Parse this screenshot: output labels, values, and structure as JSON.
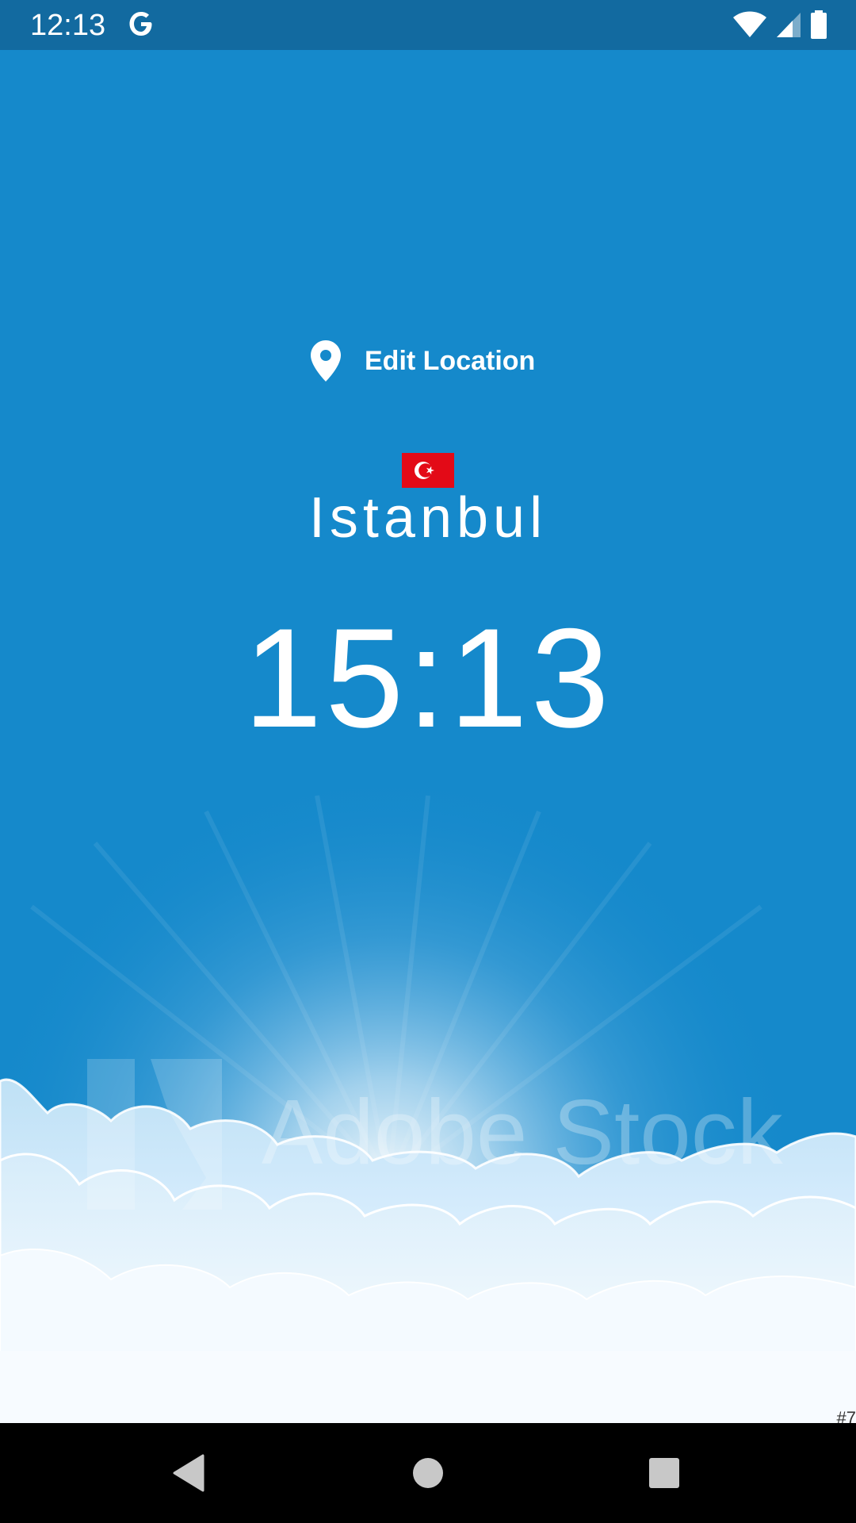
{
  "status_bar": {
    "time": "12:13",
    "notification_icon": "google-g-icon",
    "icons": [
      "wifi-icon",
      "cell-signal-icon",
      "battery-icon"
    ]
  },
  "location": {
    "edit_label": "Edit Location",
    "icon": "location-pin-icon"
  },
  "city": {
    "flag": "turkey-flag",
    "name": "Istanbul",
    "time": "15:13"
  },
  "background": {
    "watermark_text": "Adobe Stock",
    "corner_text": "#7"
  },
  "nav_bar": {
    "buttons": [
      "back-icon",
      "home-icon",
      "recents-icon"
    ]
  },
  "colors": {
    "sky": "#1589cb",
    "status_bar": "#126aa0",
    "flag_red": "#e30a17"
  }
}
